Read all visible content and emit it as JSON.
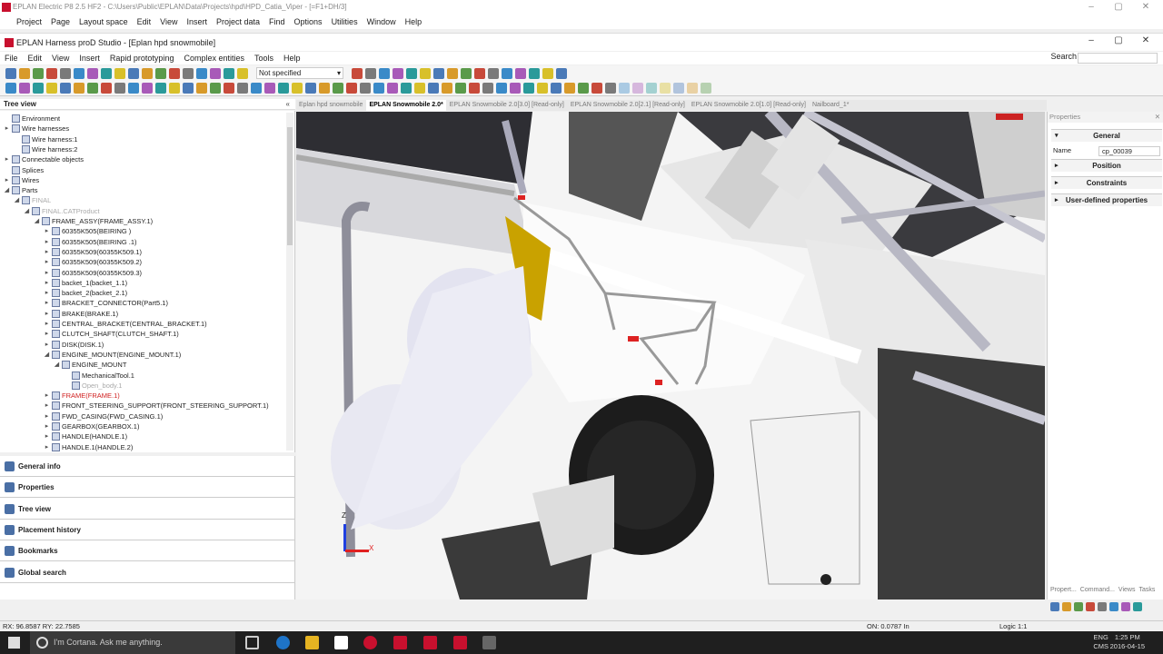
{
  "outer_window": {
    "title": "EPLAN Electric P8 2.5 HF2 - C:\\Users\\Public\\EPLAN\\Data\\Projects\\hpd\\HPD_Catia_Viper - [=F1+DH/3]",
    "menu": [
      "Project",
      "Page",
      "Layout space",
      "Edit",
      "View",
      "Insert",
      "Project data",
      "Find",
      "Options",
      "Utilities",
      "Window",
      "Help"
    ]
  },
  "inner_window": {
    "title": "EPLAN Harness proD Studio - [Eplan hpd snowmobile]",
    "menu": [
      "File",
      "Edit",
      "View",
      "Insert",
      "Rapid prototyping",
      "Complex entities",
      "Tools",
      "Help"
    ],
    "search_label": "Search"
  },
  "toolbar": {
    "dropdown_value": "Not specified"
  },
  "tree": {
    "header": "Tree view",
    "items": [
      {
        "label": "Environment",
        "level": 0,
        "exp": "",
        "style": ""
      },
      {
        "label": "Wire harnesses",
        "level": 0,
        "exp": "▸",
        "style": ""
      },
      {
        "label": "Wire harness:1",
        "level": 1,
        "exp": "",
        "style": ""
      },
      {
        "label": "Wire harness:2",
        "level": 1,
        "exp": "",
        "style": ""
      },
      {
        "label": "Connectable objects",
        "level": 0,
        "exp": "▸",
        "style": ""
      },
      {
        "label": "Splices",
        "level": 0,
        "exp": "",
        "style": ""
      },
      {
        "label": "Wires",
        "level": 0,
        "exp": "▸",
        "style": ""
      },
      {
        "label": "Parts",
        "level": 0,
        "exp": "◢",
        "style": ""
      },
      {
        "label": "FINAL",
        "level": 1,
        "exp": "◢",
        "style": "gray"
      },
      {
        "label": "FINAL.CATProduct",
        "level": 2,
        "exp": "◢",
        "style": "gray"
      },
      {
        "label": "FRAME_ASSY(FRAME_ASSY.1)",
        "level": 3,
        "exp": "◢",
        "style": ""
      },
      {
        "label": "60355K505(BEIRING )",
        "level": 4,
        "exp": "▸",
        "style": ""
      },
      {
        "label": "60355K505(BEIRING .1)",
        "level": 4,
        "exp": "▸",
        "style": ""
      },
      {
        "label": "60355K509(60355K509.1)",
        "level": 4,
        "exp": "▸",
        "style": ""
      },
      {
        "label": "60355K509(60355K509.2)",
        "level": 4,
        "exp": "▸",
        "style": ""
      },
      {
        "label": "60355K509(60355K509.3)",
        "level": 4,
        "exp": "▸",
        "style": ""
      },
      {
        "label": "backet_1(backet_1.1)",
        "level": 4,
        "exp": "▸",
        "style": ""
      },
      {
        "label": "backet_2(backet_2.1)",
        "level": 4,
        "exp": "▸",
        "style": ""
      },
      {
        "label": "BRACKET_CONNECTOR(Part5.1)",
        "level": 4,
        "exp": "▸",
        "style": ""
      },
      {
        "label": "BRAKE(BRAKE.1)",
        "level": 4,
        "exp": "▸",
        "style": ""
      },
      {
        "label": "CENTRAL_BRACKET(CENTRAL_BRACKET.1)",
        "level": 4,
        "exp": "▸",
        "style": ""
      },
      {
        "label": "CLUTCH_SHAFT(CLUTCH_SHAFT.1)",
        "level": 4,
        "exp": "▸",
        "style": ""
      },
      {
        "label": "DISK(DISK.1)",
        "level": 4,
        "exp": "▸",
        "style": ""
      },
      {
        "label": "ENGINE_MOUNT(ENGINE_MOUNT.1)",
        "level": 4,
        "exp": "◢",
        "style": ""
      },
      {
        "label": "ENGINE_MOUNT",
        "level": 5,
        "exp": "◢",
        "style": ""
      },
      {
        "label": "MechanicalTool.1",
        "level": 6,
        "exp": "",
        "style": ""
      },
      {
        "label": "Open_body.1",
        "level": 6,
        "exp": "",
        "style": "gray"
      },
      {
        "label": "FRAME(FRAME.1)",
        "level": 4,
        "exp": "▸",
        "style": "red"
      },
      {
        "label": "FRONT_STEERING_SUPPORT(FRONT_STEERING_SUPPORT.1)",
        "level": 4,
        "exp": "▸",
        "style": ""
      },
      {
        "label": "FWD_CASING(FWD_CASING.1)",
        "level": 4,
        "exp": "▸",
        "style": ""
      },
      {
        "label": "GEARBOX(GEARBOX.1)",
        "level": 4,
        "exp": "▸",
        "style": ""
      },
      {
        "label": "HANDLE(HANDLE.1)",
        "level": 4,
        "exp": "▸",
        "style": ""
      },
      {
        "label": "HANDLE.1(HANDLE.2)",
        "level": 4,
        "exp": "▸",
        "style": ""
      }
    ]
  },
  "nav_panel": [
    "General info",
    "Properties",
    "Tree view",
    "Placement history",
    "Bookmarks",
    "Global search"
  ],
  "doc_tabs": [
    {
      "label": "Eplan hpd snowmobile",
      "active": false
    },
    {
      "label": "EPLAN Snowmobile 2.0*",
      "active": true
    },
    {
      "label": "EPLAN Snowmobile 2.0[3.0] [Read-only]",
      "active": false
    },
    {
      "label": "EPLAN Snowmobile 2.0[2.1] [Read-only]",
      "active": false
    },
    {
      "label": "EPLAN Snowmobile 2.0[1.0] [Read-only]",
      "active": false
    },
    {
      "label": "Nailboard_1*",
      "active": false
    }
  ],
  "viewport": {
    "axis_x": "X",
    "axis_z": "Z"
  },
  "properties": {
    "header": "Properties",
    "sections": [
      "General",
      "Position",
      "Constraints",
      "User-defined properties"
    ],
    "name_label": "Name",
    "name_value": "cp_00039",
    "bottom_tabs": [
      "Propert...",
      "Command...",
      "Views",
      "Tasks"
    ]
  },
  "status": {
    "coords": "RX: 96.8587   RY: 22.7585",
    "on_value": "ON: 0.0787 In",
    "logic": "Logic 1:1"
  },
  "taskbar": {
    "cortana": "I'm Cortana. Ask me anything.",
    "lang": "ENG",
    "lang2": "CMS",
    "time": "1:25 PM",
    "date": "2016-04-15"
  }
}
